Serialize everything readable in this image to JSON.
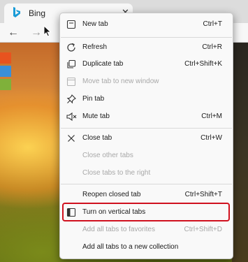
{
  "browser": {
    "tab_title": "Bing",
    "tab_close_glyph": "✕",
    "back_glyph": "←",
    "forward_glyph": "→"
  },
  "menu": {
    "new_tab": {
      "label": "New tab",
      "shortcut": "Ctrl+T",
      "icon": "new-tab-icon"
    },
    "refresh": {
      "label": "Refresh",
      "shortcut": "Ctrl+R",
      "icon": "refresh-icon"
    },
    "duplicate_tab": {
      "label": "Duplicate tab",
      "shortcut": "Ctrl+Shift+K",
      "icon": "duplicate-icon"
    },
    "move_tab": {
      "label": "Move tab to new window",
      "shortcut": "",
      "icon": "move-window-icon",
      "disabled": true
    },
    "pin_tab": {
      "label": "Pin tab",
      "shortcut": "",
      "icon": "pin-icon"
    },
    "mute_tab": {
      "label": "Mute tab",
      "shortcut": "Ctrl+M",
      "icon": "speaker-mute-icon"
    },
    "close_tab": {
      "label": "Close tab",
      "shortcut": "Ctrl+W",
      "icon": "close-icon"
    },
    "close_other_tabs": {
      "label": "Close other tabs",
      "shortcut": "",
      "disabled": true
    },
    "close_tabs_right": {
      "label": "Close tabs to the right",
      "shortcut": "",
      "disabled": true
    },
    "reopen_closed_tab": {
      "label": "Reopen closed tab",
      "shortcut": "Ctrl+Shift+T"
    },
    "vertical_tabs": {
      "label": "Turn on vertical tabs",
      "shortcut": "",
      "icon": "vertical-tabs-icon",
      "highlighted": true
    },
    "add_all_favorites": {
      "label": "Add all tabs to favorites",
      "shortcut": "Ctrl+Shift+D",
      "disabled": true
    },
    "add_all_collection": {
      "label": "Add all tabs to a new collection",
      "shortcut": ""
    }
  },
  "colors": {
    "highlight_border": "#d0101e",
    "disabled_text": "#a8a8a8",
    "bing_teal": "#1a9bd7"
  }
}
